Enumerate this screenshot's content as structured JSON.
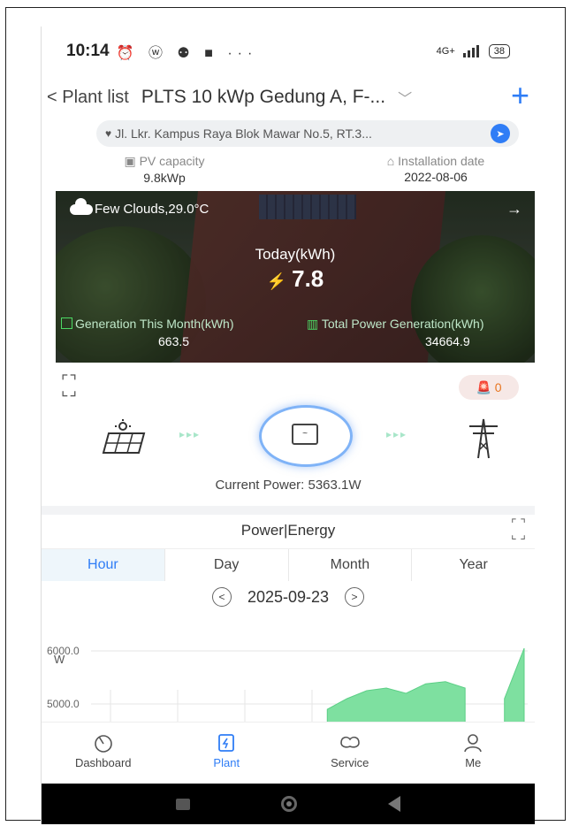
{
  "status_bar": {
    "time": "10:14",
    "notif_icons": "⏰ ⓦ ⚉ ■ ···",
    "network": "4G+",
    "battery": "38"
  },
  "nav": {
    "back_label": "< Plant list",
    "plant_title": "PLTS 10 kWp Gedung A, F-...",
    "dropdown_icon": "chevron-down-icon",
    "add_icon": "plus-icon"
  },
  "address": {
    "text": "Jl. Lkr. Kampus Raya Blok Mawar No.5, RT.3..."
  },
  "plant_info": {
    "pv_capacity_label": "PV capacity",
    "pv_capacity_value": "9.8kWp",
    "install_date_label": "Installation date",
    "install_date_value": "2022-08-06"
  },
  "hero": {
    "weather": "Few Clouds,29.0°C",
    "today_label": "Today(kWh)",
    "today_value": "7.8",
    "gen_month_label": "Generation This Month(kWh)",
    "gen_month_value": "663.5",
    "total_gen_label": "Total Power Generation(kWh)",
    "total_gen_value": "34664.9"
  },
  "alarm": {
    "count": "0"
  },
  "flow": {
    "current_power": "Current Power: 5363.1W"
  },
  "energy": {
    "title": "Power|Energy",
    "tabs": [
      "Hour",
      "Day",
      "Month",
      "Year"
    ],
    "active_tab": "Hour",
    "date": "2025-09-23"
  },
  "chart_data": {
    "type": "area",
    "ylabel": "W",
    "y_ticks": [
      "6000.0",
      "5000.0"
    ],
    "ylim": [
      4600,
      6600
    ],
    "series": [
      {
        "values": [
          0,
          0,
          0,
          0,
          0,
          0,
          0,
          0,
          0,
          0,
          0,
          0,
          4900,
          5100,
          5250,
          5300,
          5200,
          5380,
          5420,
          5300,
          0,
          5100,
          6050
        ]
      }
    ],
    "color": "#7ee0a0"
  },
  "bottom_nav": {
    "items": [
      "Dashboard",
      "Plant",
      "Service",
      "Me"
    ],
    "active": "Plant"
  },
  "colors": {
    "accent": "#2f7df6",
    "green": "#4cd964",
    "alarm": "#e8741e"
  }
}
